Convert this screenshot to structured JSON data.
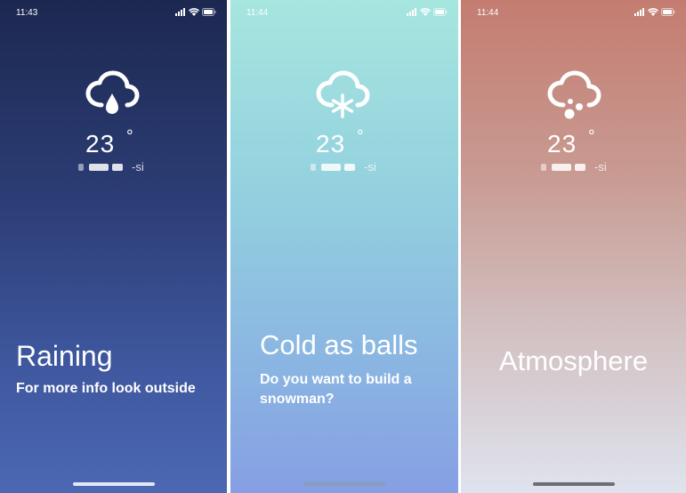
{
  "screens": [
    {
      "status": {
        "time": "11:43"
      },
      "weather_icon": "rain-cloud-icon",
      "temperature": "23",
      "unit": "°",
      "location_suffix": "-si",
      "headline": "Raining",
      "subline": "For more info look outside"
    },
    {
      "status": {
        "time": "11:44"
      },
      "weather_icon": "snow-cloud-icon",
      "temperature": "23",
      "unit": "°",
      "location_suffix": "-si",
      "headline": "Cold as balls",
      "subline": "Do you want to build a snowman?"
    },
    {
      "status": {
        "time": "11:44"
      },
      "weather_icon": "atmosphere-cloud-icon",
      "temperature": "23",
      "unit": "°",
      "location_suffix": "-si",
      "headline": "Atmosphere",
      "subline": ""
    }
  ],
  "colors": {
    "rain_gradient": [
      "#1c2850",
      "#4c68b3"
    ],
    "snow_gradient": [
      "#a6e6df",
      "#869fe3"
    ],
    "atmosphere_gradient": [
      "#c47c70",
      "#dfe3ee"
    ]
  }
}
